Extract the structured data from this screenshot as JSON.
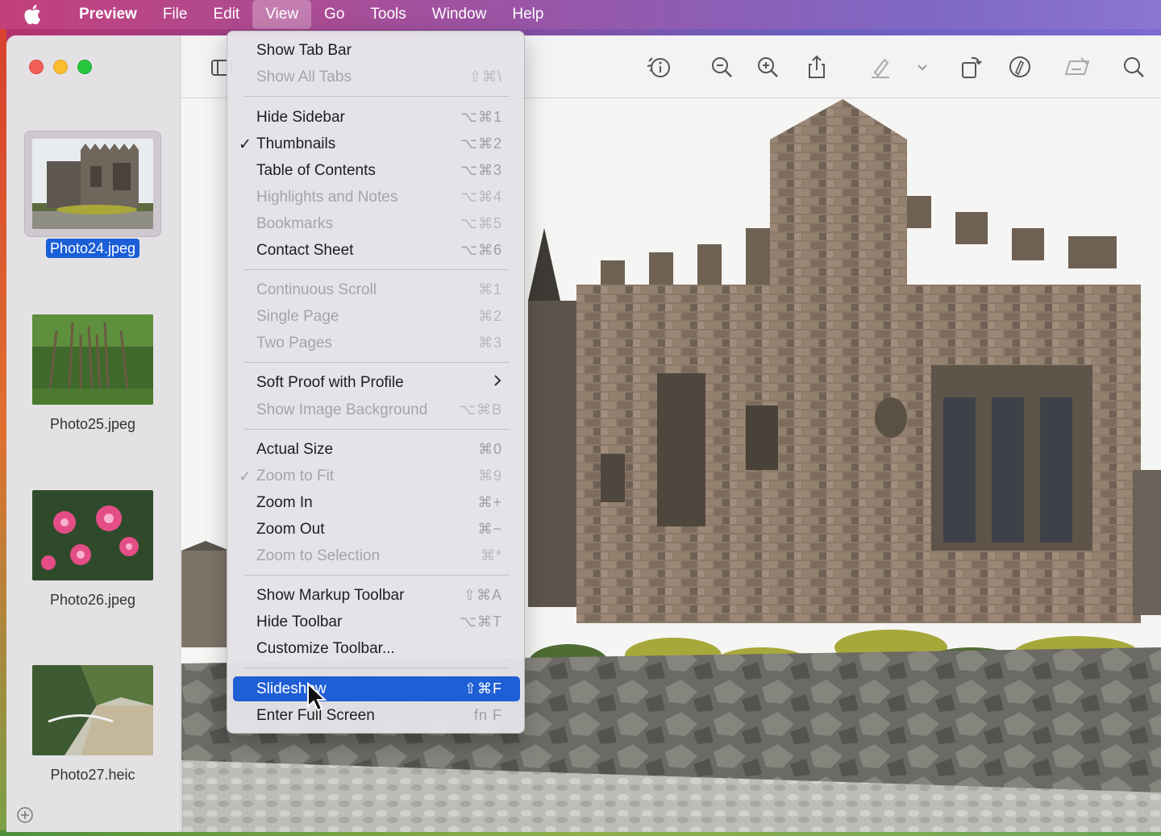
{
  "menubar": {
    "app": "Preview",
    "items": [
      "File",
      "Edit",
      "View",
      "Go",
      "Tools",
      "Window",
      "Help"
    ],
    "active": "View"
  },
  "sidebar": {
    "thumbnails": [
      {
        "name": "Photo24.jpeg",
        "selected": true
      },
      {
        "name": "Photo25.jpeg",
        "selected": false
      },
      {
        "name": "Photo26.jpeg",
        "selected": false
      },
      {
        "name": "Photo27.heic",
        "selected": false
      }
    ]
  },
  "toolbar": {
    "icons": [
      "sidebar-toggle-icon",
      "info-icon",
      "zoom-out-icon",
      "zoom-in-icon",
      "share-icon",
      "highlight-pen-icon",
      "chevron-down-icon",
      "rotate-icon",
      "markup-icon",
      "redact-icon",
      "search-icon"
    ]
  },
  "view_menu": {
    "items": [
      {
        "label": "Show Tab Bar",
        "shortcut": "",
        "enabled": true
      },
      {
        "label": "Show All Tabs",
        "shortcut": "⇧⌘\\",
        "enabled": false
      },
      {
        "label": "Hide Sidebar",
        "shortcut": "⌥⌘1",
        "enabled": true
      },
      {
        "label": "Thumbnails",
        "shortcut": "⌥⌘2",
        "enabled": true,
        "checked": true
      },
      {
        "label": "Table of Contents",
        "shortcut": "⌥⌘3",
        "enabled": true
      },
      {
        "label": "Highlights and Notes",
        "shortcut": "⌥⌘4",
        "enabled": false
      },
      {
        "label": "Bookmarks",
        "shortcut": "⌥⌘5",
        "enabled": false
      },
      {
        "label": "Contact Sheet",
        "shortcut": "⌥⌘6",
        "enabled": true
      },
      {
        "label": "Continuous Scroll",
        "shortcut": "⌘1",
        "enabled": false
      },
      {
        "label": "Single Page",
        "shortcut": "⌘2",
        "enabled": false
      },
      {
        "label": "Two Pages",
        "shortcut": "⌘3",
        "enabled": false
      },
      {
        "label": "Soft Proof with Profile",
        "shortcut": "",
        "enabled": true,
        "submenu": true
      },
      {
        "label": "Show Image Background",
        "shortcut": "⌥⌘B",
        "enabled": false
      },
      {
        "label": "Actual Size",
        "shortcut": "⌘0",
        "enabled": true
      },
      {
        "label": "Zoom to Fit",
        "shortcut": "⌘9",
        "enabled": false,
        "checked": true
      },
      {
        "label": "Zoom In",
        "shortcut": "⌘+",
        "enabled": true
      },
      {
        "label": "Zoom Out",
        "shortcut": "⌘−",
        "enabled": true
      },
      {
        "label": "Zoom to Selection",
        "shortcut": "⌘*",
        "enabled": false
      },
      {
        "label": "Show Markup Toolbar",
        "shortcut": "⇧⌘A",
        "enabled": true
      },
      {
        "label": "Hide Toolbar",
        "shortcut": "⌥⌘T",
        "enabled": true
      },
      {
        "label": "Customize Toolbar...",
        "shortcut": "",
        "enabled": true
      },
      {
        "label": "Slideshow",
        "shortcut": "⇧⌘F",
        "enabled": true,
        "highlighted": true
      },
      {
        "label": "Enter Full Screen",
        "shortcut": "fn F",
        "enabled": true
      }
    ]
  },
  "colors": {
    "accent": "#1f5fd6",
    "close": "#f15f56",
    "minimize": "#fbbd2e",
    "zoom": "#27c840"
  }
}
